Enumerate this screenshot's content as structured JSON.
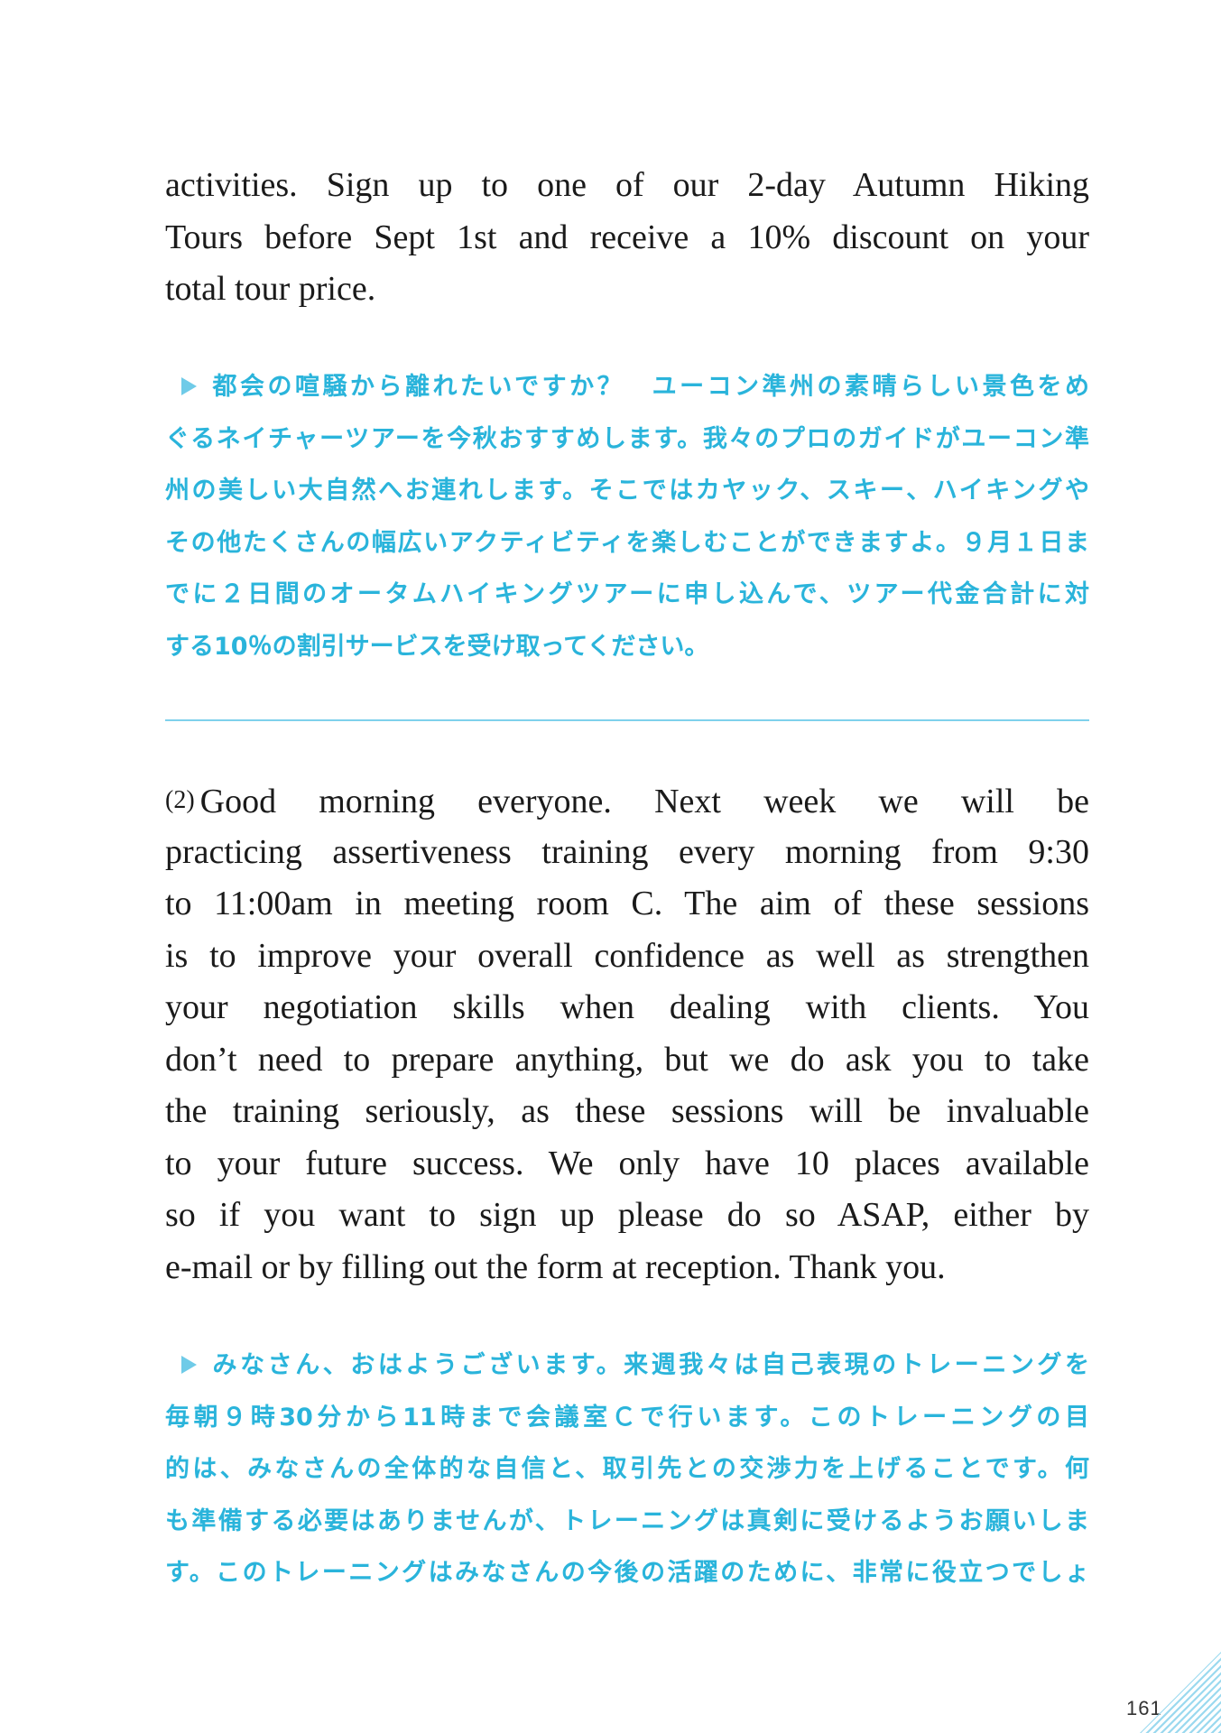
{
  "passage_1": {
    "english_lines": [
      "activities. Sign up to one of our 2-day Autumn Hiking",
      "Tours before Sept 1st and receive a 10% discount on your",
      "total tour price."
    ],
    "japanese_lines": [
      "都会の喧騒から離れたいですか？　ユーコン準州の素晴らしい景色をめ",
      "ぐるネイチャーツアーを今秋おすすめします。我々のプロのガイドがユーコン準",
      "州の美しい大自然へお連れします。そこではカヤック、スキー、ハイキングや",
      "その他たくさんの幅広いアクティビティを楽しむことができますよ。９月１日ま",
      "でに２日間のオータムハイキングツアーに申し込んで、ツアー代金合計に対",
      "する10％の割引サービスを受け取ってください。"
    ]
  },
  "passage_2": {
    "number": "(2)",
    "english_lines": [
      "Good morning everyone. Next week we will be",
      "practicing assertiveness training every morning from 9:30",
      "to 11:00am in meeting room C. The aim of these sessions",
      "is to improve your overall confidence as well as strengthen",
      "your negotiation skills when dealing with clients. You",
      "don’t need to prepare anything, but we do ask you to take",
      "the training seriously, as these sessions will be invaluable",
      "to your future success. We only have 10 places available",
      "so if you want to sign up please do so ASAP, either by",
      "e-mail or by filling out the form at reception. Thank you."
    ],
    "japanese_lines": [
      "みなさん、おはようございます。来週我々は自己表現のトレーニングを",
      "毎朝９時30分から11時まで会議室Ｃで行います。このトレーニングの目",
      "的は、みなさんの全体的な自信と、取引先との交渉力を上げることです。何",
      "も準備する必要はありませんが、トレーニングは真剣に受けるようお願いしま",
      "す。このトレーニングはみなさんの今後の活躍のために、非常に役立つでしょ"
    ]
  },
  "page_number": "161",
  "colors": {
    "translation_text": "#2ab4db",
    "marker": "#6fcbe8",
    "divider": "#7fd1ec",
    "body_text": "#1a1a1a"
  },
  "icons": {
    "translation_marker": "play-triangle-icon"
  }
}
